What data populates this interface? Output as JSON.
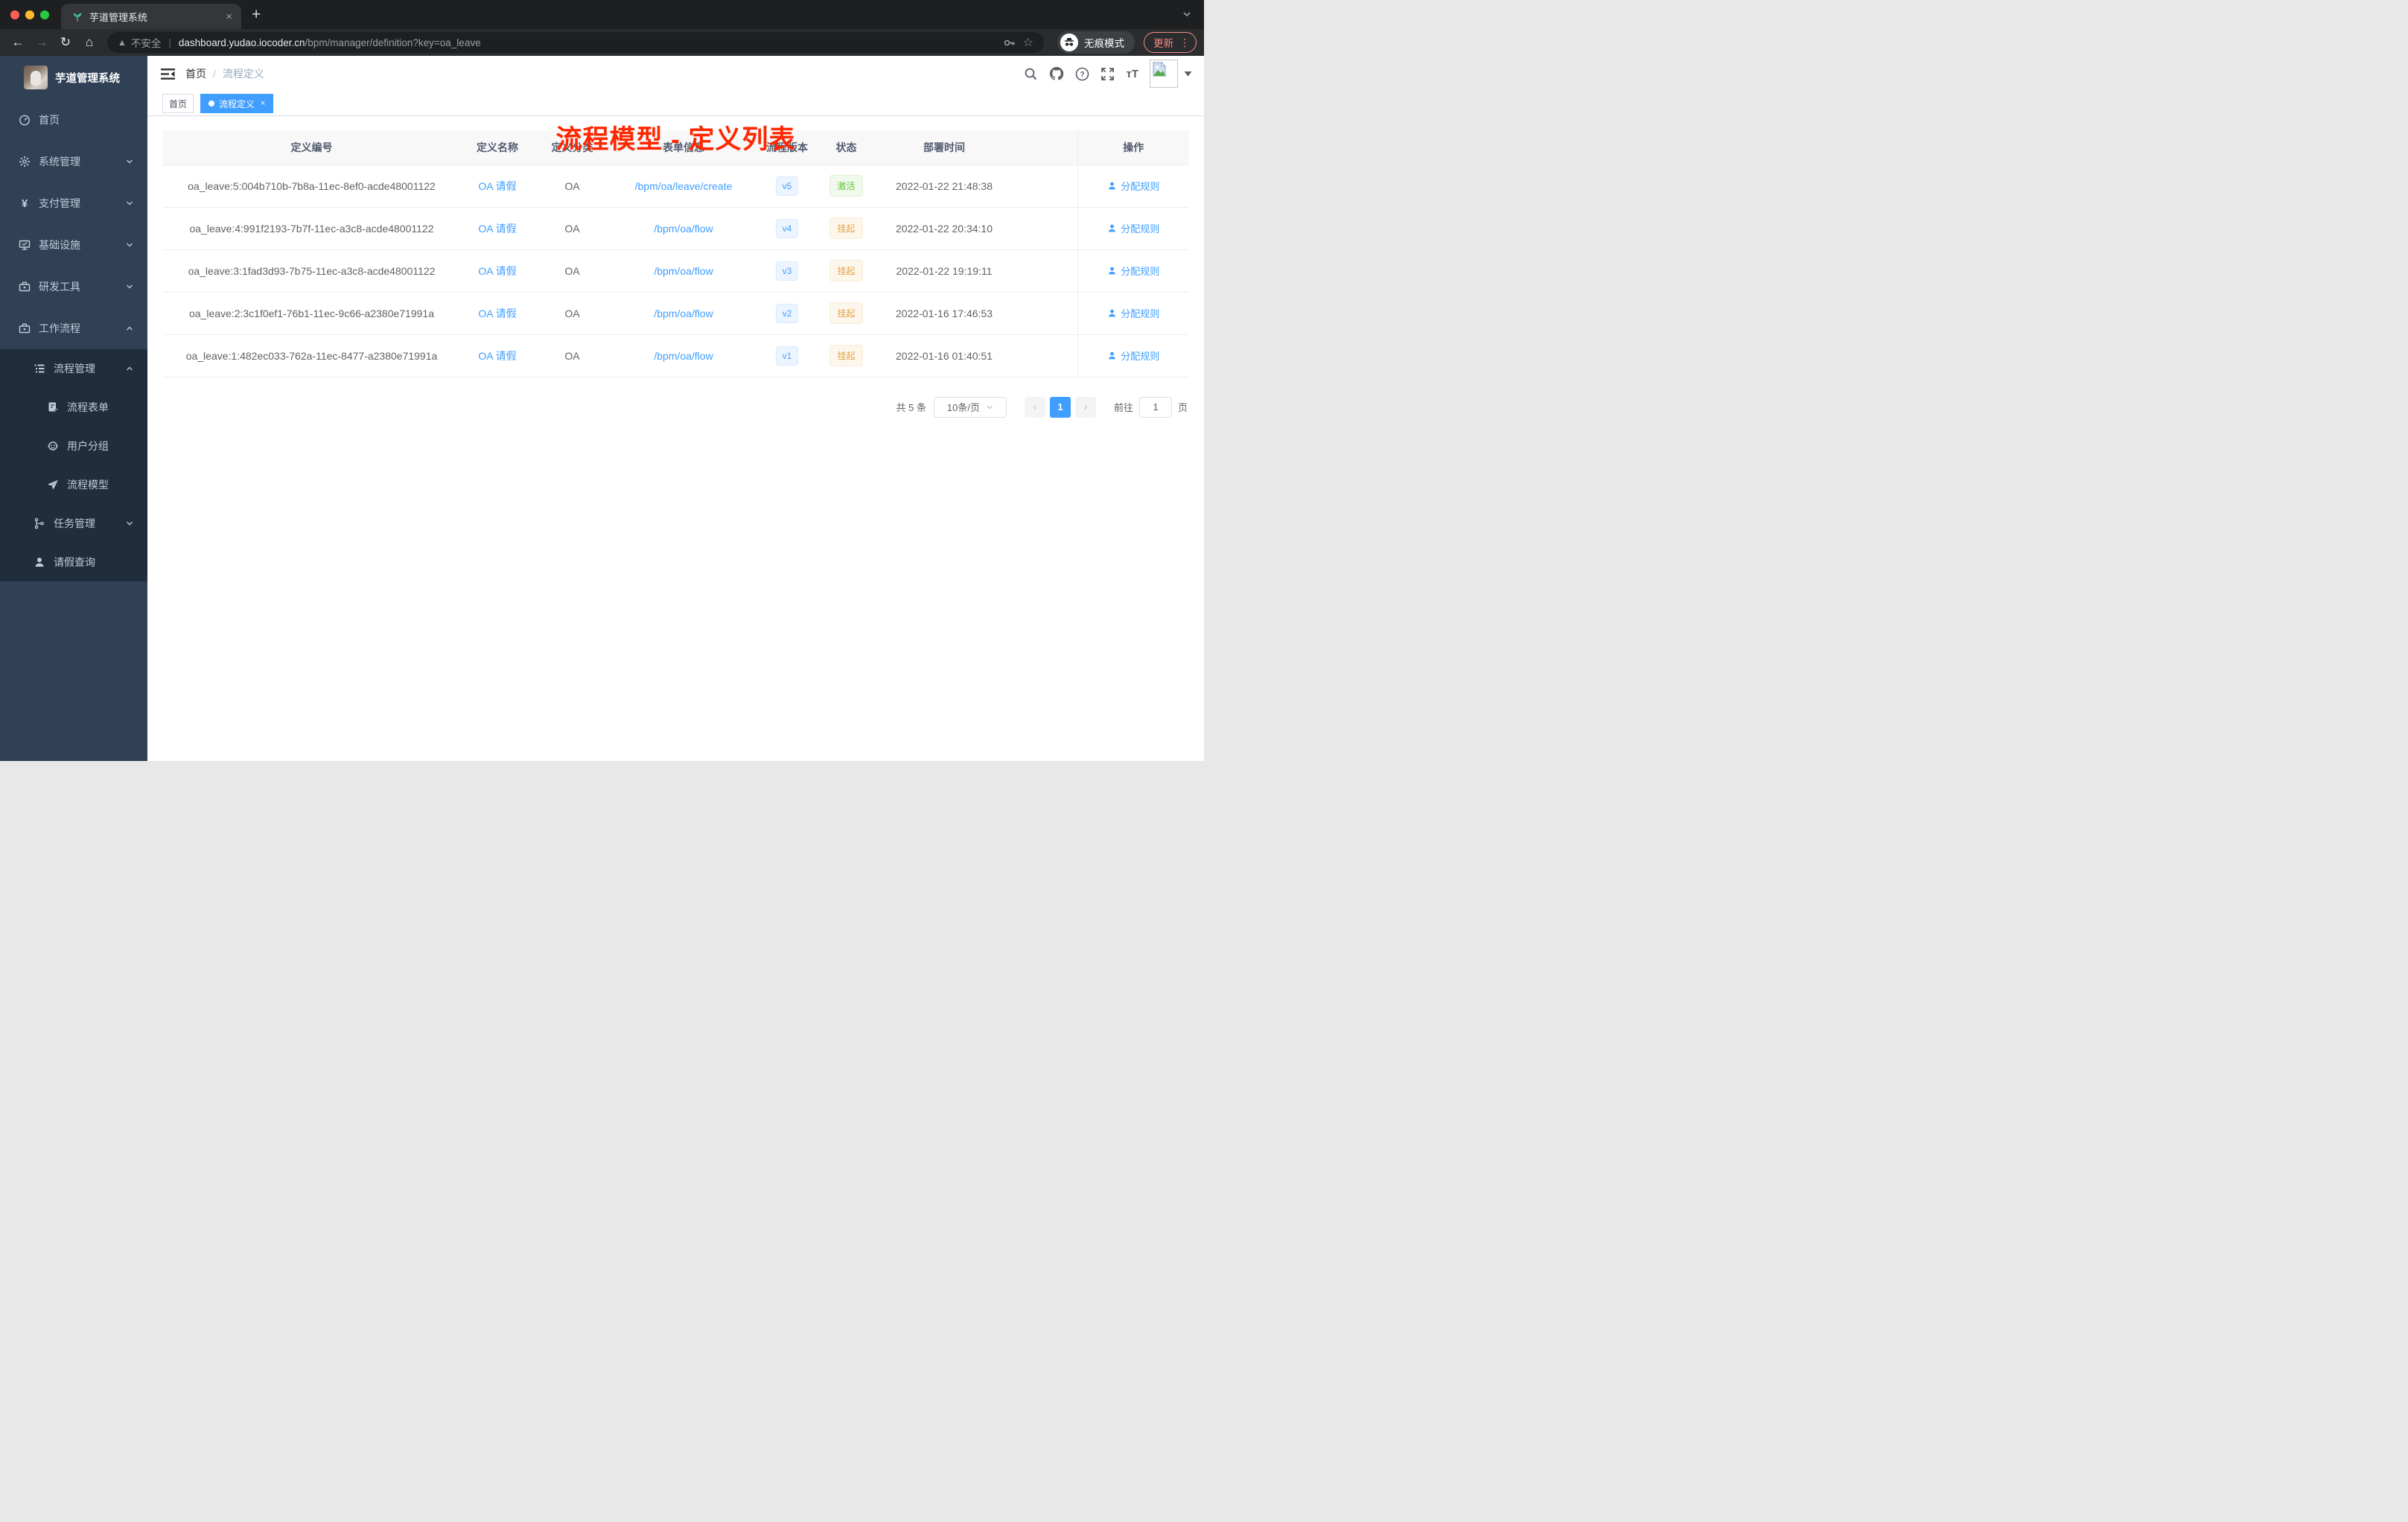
{
  "browser": {
    "tab_title": "芋道管理系统",
    "tab_close": "×",
    "new_tab": "+",
    "security_label": "不安全",
    "url_separator": "|",
    "url_domain": "dashboard.yudao.iocoder.cn",
    "url_path": "/bpm/manager/definition?key=oa_leave",
    "incognito_label": "无痕模式",
    "update_label": "更新",
    "menu_dots": "⋮"
  },
  "sidebar": {
    "title": "芋道管理系统",
    "items": [
      {
        "label": "首页",
        "icon": "dashboard-icon"
      },
      {
        "label": "系统管理",
        "icon": "gear-icon"
      },
      {
        "label": "支付管理",
        "icon": "yen-icon"
      },
      {
        "label": "基础设施",
        "icon": "monitor-icon"
      },
      {
        "label": "研发工具",
        "icon": "toolbox-icon"
      },
      {
        "label": "工作流程",
        "icon": "workflow-icon"
      },
      {
        "label": "流程管理",
        "icon": "list-icon"
      },
      {
        "label": "流程表单",
        "icon": "form-icon"
      },
      {
        "label": "用户分组",
        "icon": "robot-icon"
      },
      {
        "label": "流程模型",
        "icon": "paper-plane-icon"
      },
      {
        "label": "任务管理",
        "icon": "tree-icon"
      },
      {
        "label": "请假查询",
        "icon": "user-icon"
      }
    ]
  },
  "header": {
    "breadcrumb": {
      "home": "首页",
      "separator": "/",
      "current": "流程定义"
    },
    "annotation": "流程模型 - 定义列表"
  },
  "tags": {
    "home": "首页",
    "active": "流程定义",
    "close": "×"
  },
  "table": {
    "columns": [
      "定义编号",
      "定义名称",
      "定义分类",
      "表单信息",
      "流程版本",
      "状态",
      "部署时间",
      "操作"
    ],
    "rows": [
      {
        "id": "oa_leave:5:004b710b-7b8a-11ec-8ef0-acde48001122",
        "name": "OA 请假",
        "category": "OA",
        "form": "/bpm/oa/leave/create",
        "version": "v5",
        "status": "激活",
        "time": "2022-01-22 21:48:38",
        "action": "分配规则"
      },
      {
        "id": "oa_leave:4:991f2193-7b7f-11ec-a3c8-acde48001122",
        "name": "OA 请假",
        "category": "OA",
        "form": "/bpm/oa/flow",
        "version": "v4",
        "status": "挂起",
        "time": "2022-01-22 20:34:10",
        "action": "分配规则"
      },
      {
        "id": "oa_leave:3:1fad3d93-7b75-11ec-a3c8-acde48001122",
        "name": "OA 请假",
        "category": "OA",
        "form": "/bpm/oa/flow",
        "version": "v3",
        "status": "挂起",
        "time": "2022-01-22 19:19:11",
        "action": "分配规则"
      },
      {
        "id": "oa_leave:2:3c1f0ef1-76b1-11ec-9c66-a2380e71991a",
        "name": "OA 请假",
        "category": "OA",
        "form": "/bpm/oa/flow",
        "version": "v2",
        "status": "挂起",
        "time": "2022-01-16 17:46:53",
        "action": "分配规则"
      },
      {
        "id": "oa_leave:1:482ec033-762a-11ec-8477-a2380e71991a",
        "name": "OA 请假",
        "category": "OA",
        "form": "/bpm/oa/flow",
        "version": "v1",
        "status": "挂起",
        "time": "2022-01-16 01:40:51",
        "action": "分配规则"
      }
    ]
  },
  "pagination": {
    "total": "共 5 条",
    "page_size": "10条/页",
    "prev": "‹",
    "page": "1",
    "next": "›",
    "goto_label": "前往",
    "goto_value": "1",
    "goto_unit": "页"
  },
  "colors": {
    "accent": "#409eff",
    "annotation_red": "#ff2600",
    "status_active_green": "#67c23a",
    "status_suspend_orange": "#e6a23c",
    "sidebar_bg": "#304156",
    "submenu_bg": "#1f2d3d"
  }
}
